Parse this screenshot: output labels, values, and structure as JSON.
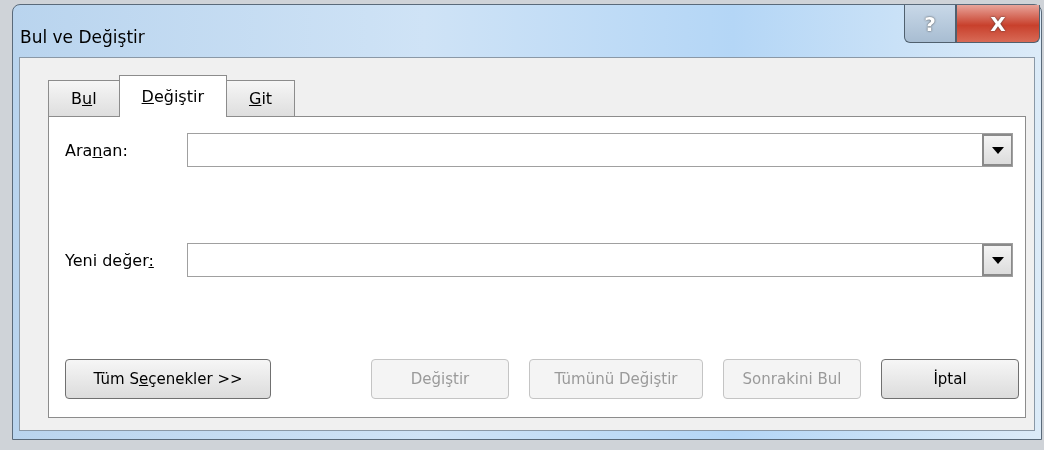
{
  "window": {
    "title": "Bul ve Değiştir",
    "title_buttons": [
      {
        "kind": "help",
        "label": "?"
      },
      {
        "kind": "close",
        "label": "X"
      }
    ]
  },
  "tabs": [
    {
      "label": {
        "pre": "B",
        "key": "u",
        "post": "l"
      },
      "selected": false
    },
    {
      "label": {
        "key": "D",
        "post": "eğiştir"
      },
      "selected": true
    },
    {
      "label": {
        "key": "G",
        "post": "it"
      },
      "selected": false
    }
  ],
  "fields": [
    {
      "label": {
        "pre": "Ara",
        "key": "n",
        "post": "an:"
      }
    },
    {
      "label": {
        "pre": "Yeni değer",
        "key": ":"
      }
    }
  ],
  "buttons": [
    {
      "label": {
        "pre": "Tüm S",
        "key": "e",
        "post": "çenekler >>"
      },
      "disabled": false
    },
    {
      "label": {
        "pre": "Değiştir"
      },
      "disabled": true
    },
    {
      "label": {
        "pre": "Tümünü Değiştir"
      },
      "disabled": true
    },
    {
      "label": {
        "pre": "Sonrakini Bul"
      },
      "disabled": true
    },
    {
      "label": {
        "pre": "İptal"
      },
      "disabled": false
    }
  ]
}
